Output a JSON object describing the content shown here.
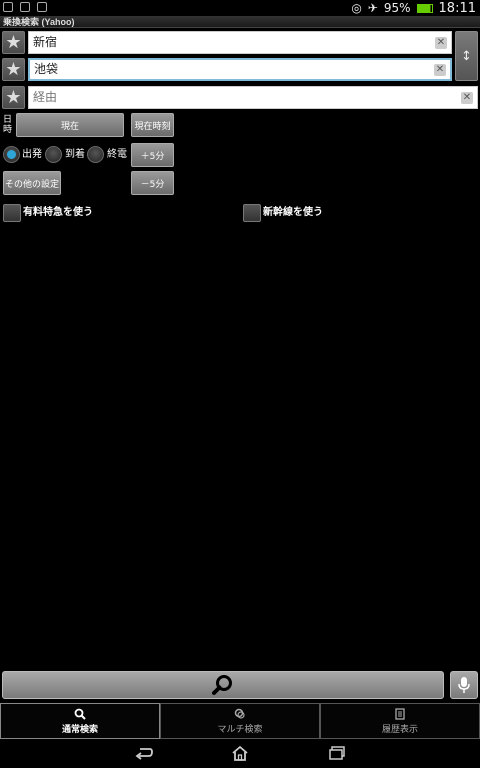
{
  "status_bar": {
    "battery": "95%",
    "time": "18:11"
  },
  "app": {
    "title": "乗換検索 (Yahoo)"
  },
  "route": {
    "from_value": "新宿",
    "to_value": "池袋",
    "via_placeholder": "経由",
    "swap_symbol": "↕"
  },
  "datetime": {
    "label": "日時",
    "now_date_button": "現在",
    "now_time_button": "現在時刻",
    "plus5_button": "＋5分",
    "minus5_button": "－5分",
    "other_settings_button": "その他の設定"
  },
  "mode": {
    "options": [
      "出発",
      "到着",
      "終電"
    ],
    "selected": "出発"
  },
  "options": {
    "paid_express_label": "有料特急を使う",
    "shinkansen_label": "新幹線を使う"
  },
  "tabs": [
    {
      "label": "通常検索",
      "icon": "search-icon",
      "active": true
    },
    {
      "label": "マルチ検索",
      "icon": "multi-search-icon",
      "active": false
    },
    {
      "label": "履歴表示",
      "icon": "history-icon",
      "active": false
    }
  ],
  "colors": {
    "accent": "#2ea6d8",
    "background": "#000000"
  }
}
